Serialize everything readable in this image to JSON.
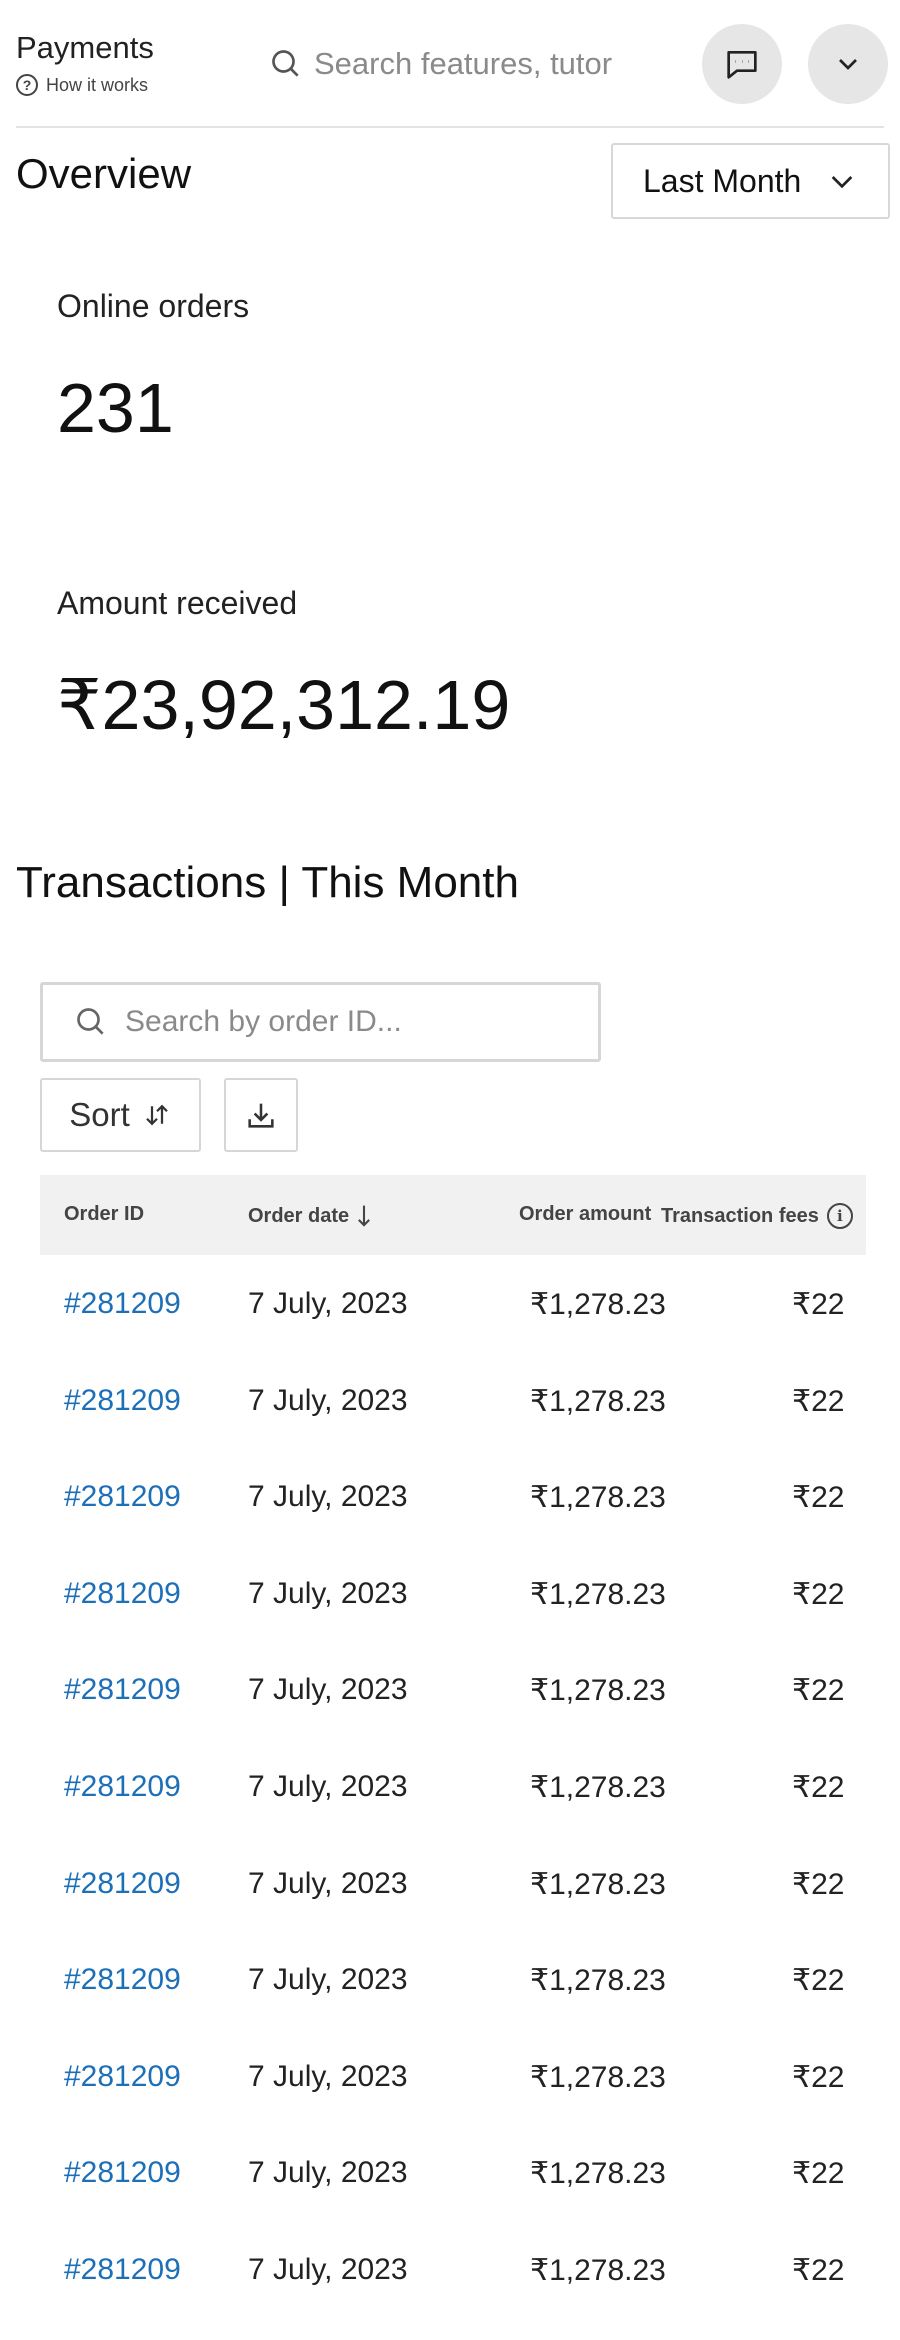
{
  "header": {
    "app_title": "Payments",
    "how_it_works": "How it works",
    "search_placeholder": "Search features, tutorials"
  },
  "overview": {
    "title": "Overview",
    "period": "Last Month",
    "stats": [
      {
        "label": "Online orders",
        "value": "231"
      },
      {
        "label": "Amount received",
        "value": "₹23,92,312.19"
      }
    ]
  },
  "transactions": {
    "title": "Transactions | This Month",
    "search_placeholder": "Search by order ID...",
    "sort_label": "Sort",
    "columns": {
      "order_id": "Order ID",
      "order_date": "Order date",
      "order_amount": "Order amount",
      "transaction_fees": "Transaction fees"
    },
    "rows": [
      {
        "id": "#281209",
        "date": "7 July, 2023",
        "amount": "₹1,278.23",
        "fees": "₹22"
      },
      {
        "id": "#281209",
        "date": "7 July, 2023",
        "amount": "₹1,278.23",
        "fees": "₹22"
      },
      {
        "id": "#281209",
        "date": "7 July, 2023",
        "amount": "₹1,278.23",
        "fees": "₹22"
      },
      {
        "id": "#281209",
        "date": "7 July, 2023",
        "amount": "₹1,278.23",
        "fees": "₹22"
      },
      {
        "id": "#281209",
        "date": "7 July, 2023",
        "amount": "₹1,278.23",
        "fees": "₹22"
      },
      {
        "id": "#281209",
        "date": "7 July, 2023",
        "amount": "₹1,278.23",
        "fees": "₹22"
      },
      {
        "id": "#281209",
        "date": "7 July, 2023",
        "amount": "₹1,278.23",
        "fees": "₹22"
      },
      {
        "id": "#281209",
        "date": "7 July, 2023",
        "amount": "₹1,278.23",
        "fees": "₹22"
      },
      {
        "id": "#281209",
        "date": "7 July, 2023",
        "amount": "₹1,278.23",
        "fees": "₹22"
      },
      {
        "id": "#281209",
        "date": "7 July, 2023",
        "amount": "₹1,278.23",
        "fees": "₹22"
      },
      {
        "id": "#281209",
        "date": "7 July, 2023",
        "amount": "₹1,278.23",
        "fees": "₹22"
      }
    ]
  },
  "colors": {
    "link": "#1d6fb8",
    "header_bg": "#f1f1f1",
    "circle_button": "#e6e6e6"
  },
  "icons": [
    "help-circle-icon",
    "search-icon",
    "chat-icon",
    "chevron-down-icon",
    "sort-icon",
    "download-icon",
    "arrow-down-icon",
    "info-icon"
  ]
}
